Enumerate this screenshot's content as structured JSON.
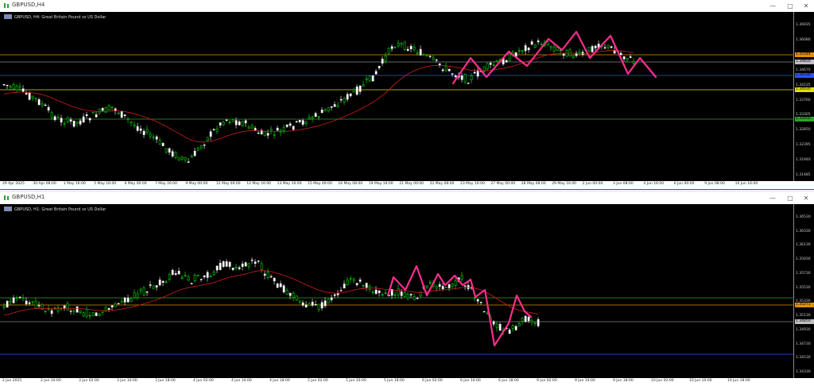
{
  "windows": [
    {
      "title": "GBPUSD,H4",
      "symbol_label": "GBPUSD, H4: Great Britain Pound vs US Dollar",
      "price_labels": [
        "1.36935",
        "1.36080",
        "1.35670",
        "1.34670",
        "1.34235",
        "1.33760",
        "1.33305",
        "1.32850",
        "1.32395",
        "1.31940",
        "1.31485"
      ],
      "price_tags": [
        {
          "text": "1.35544",
          "color": "#e09000"
        },
        {
          "text": "1.34850",
          "color": "#c0c0c0"
        },
        {
          "text": "1.34530",
          "color": "#3050ff"
        },
        {
          "text": "1.34030",
          "color": "#e0e000"
        },
        {
          "text": "1.33050",
          "color": "#30a030"
        }
      ],
      "time_labels": [
        "29 Apr 2025",
        "30 Apr 08:00",
        "1 May 16:00",
        "5 May 16:00",
        "6 May 00:00",
        "7 May 16:00",
        "9 May 00:00",
        "12 May 00:00",
        "12 May 16:00",
        "13 May 16:00",
        "15 May 00:00",
        "16 May 08:00",
        "19 May 16:00",
        "21 May 00:00",
        "22 May 08:00",
        "23 May 16:00",
        "27 May 00:00",
        "28 May 08:00",
        "29 May 16:00",
        "2 Jun 00:00",
        "3 Jun 08:00",
        "4 Jun 16:00",
        "6 Jun 00:00",
        "9 Jun 08:00",
        "10 Jun 16:00"
      ]
    },
    {
      "title": "GBPUSD,H1",
      "symbol_label": "GBPUSD, H1: Great Britain Pound vs US Dollar",
      "price_labels": [
        "1.36530",
        "1.36330",
        "1.36130",
        "1.35930",
        "1.35730",
        "1.35530",
        "1.35330",
        "1.35130",
        "1.34930",
        "1.34730",
        "1.34530",
        "1.34330"
      ],
      "price_tags": [
        {
          "text": "1.35271",
          "color": "#e09000"
        },
        {
          "text": "1.34850",
          "color": "#c0c0c0"
        }
      ],
      "time_labels": [
        "2 Jun 2025",
        "2 Jun 10:00",
        "3 Jun 02:00",
        "3 Jun 10:00",
        "3 Jun 18:00",
        "4 Jun 02:00",
        "4 Jun 10:00",
        "4 Jun 18:00",
        "5 Jun 02:00",
        "5 Jun 10:00",
        "5 Jun 18:00",
        "6 Jun 02:00",
        "6 Jun 10:00",
        "6 Jun 18:00",
        "9 Jun 02:00",
        "9 Jun 10:00",
        "9 Jun 18:00",
        "10 Jun 02:00",
        "10 Jun 10:00",
        "10 Jun 18:00"
      ]
    }
  ],
  "colors": {
    "bull": "#00ff00",
    "bear": "#ffffff",
    "ma": "#cc2020",
    "drawing": "#ff2d8c"
  }
}
